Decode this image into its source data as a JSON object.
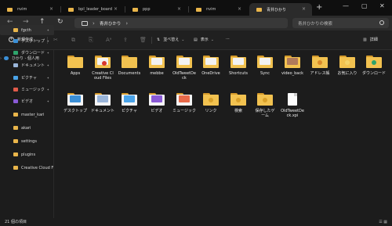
{
  "tabs": [
    {
      "label": "nvim",
      "active": false
    },
    {
      "label": "bpl_leader_board",
      "active": false
    },
    {
      "label": "ppp",
      "active": false
    },
    {
      "label": "nvim",
      "active": false
    },
    {
      "label": "青井ひかり",
      "active": true
    }
  ],
  "window": {
    "minimize": "—",
    "maximize": "▢",
    "close": "✕",
    "new_tab": "+",
    "tab_close": "×"
  },
  "nav": {
    "back": "←",
    "forward": "→",
    "up": "↑",
    "refresh": "↻"
  },
  "address": {
    "sep": "›",
    "crumb": "青井ひかり",
    "trail": "›"
  },
  "search": {
    "placeholder": "青井ひかりの検索"
  },
  "toolbar": {
    "new_label": "新規作成",
    "sort_label": "並べ替え",
    "view_label": "表示",
    "more": "···",
    "details_label": "詳細",
    "dropdown": "⌄",
    "cut": "✂",
    "copy": "⧉",
    "paste": "⎘",
    "rename": "Aᵃ",
    "share": "⇪",
    "delete": "🗑"
  },
  "sidebar": {
    "group": "ひかり - 個人用",
    "items": [
      {
        "label": "fgcth",
        "icon": "folder-icon",
        "color": "#e9b54a"
      },
      {
        "label": "デスクトップ",
        "icon": "desktop-icon",
        "color": "#3b8fd6"
      },
      {
        "label": "ダウンロード",
        "icon": "download-icon",
        "color": "#2ea36b"
      },
      {
        "label": "ドキュメント",
        "icon": "document-icon",
        "color": "#9ab5d9"
      },
      {
        "label": "ピクチャ",
        "icon": "pictures-icon",
        "color": "#4aa3e8"
      },
      {
        "label": "ミュージック",
        "icon": "music-icon",
        "color": "#e05a4a"
      },
      {
        "label": "ビデオ",
        "icon": "video-icon",
        "color": "#8a5ad6"
      },
      {
        "label": "master_kari",
        "icon": "folder-icon",
        "color": "#e9b54a"
      },
      {
        "label": "akari",
        "icon": "folder-icon",
        "color": "#e9b54a"
      },
      {
        "label": "settings",
        "icon": "folder-icon",
        "color": "#e9b54a"
      },
      {
        "label": "plugins",
        "icon": "folder-icon",
        "color": "#e9b54a"
      },
      {
        "label": "Creative Cloud F",
        "icon": "folder-icon",
        "color": "#e9b54a"
      }
    ]
  },
  "files": [
    {
      "label": "Apps",
      "type": "folder"
    },
    {
      "label": "Creative Cloud Files",
      "type": "creative"
    },
    {
      "label": "Documents",
      "type": "folder"
    },
    {
      "label": "mebbe",
      "type": "folder-doc"
    },
    {
      "label": "OldTweetDeck",
      "type": "folder-doc"
    },
    {
      "label": "OneDrive",
      "type": "folder-doc"
    },
    {
      "label": "Shortcuts",
      "type": "folder-doc"
    },
    {
      "label": "Sync",
      "type": "folder-doc"
    },
    {
      "label": "video_back",
      "type": "folder-photo"
    },
    {
      "label": "アドレス帳",
      "type": "address"
    },
    {
      "label": "お気に入り",
      "type": "favorites"
    },
    {
      "label": "ダウンロード",
      "type": "download"
    },
    {
      "label": "デスクトップ",
      "type": "desktop"
    },
    {
      "label": "ドキュメント",
      "type": "documents"
    },
    {
      "label": "ピクチャ",
      "type": "pictures"
    },
    {
      "label": "ビデオ",
      "type": "videos"
    },
    {
      "label": "ミュージック",
      "type": "music"
    },
    {
      "label": "リンク",
      "type": "links"
    },
    {
      "label": "検索",
      "type": "search"
    },
    {
      "label": "保存したゲーム",
      "type": "games"
    },
    {
      "label": "OldTweetDeck.xpi",
      "type": "file"
    }
  ],
  "status": {
    "count": "21 個の項目",
    "view_toggle": "☰ ▦"
  },
  "colors": {
    "folder": "#f2c250",
    "folder_back": "#d59a2a",
    "accent": "#3b8fd6"
  }
}
